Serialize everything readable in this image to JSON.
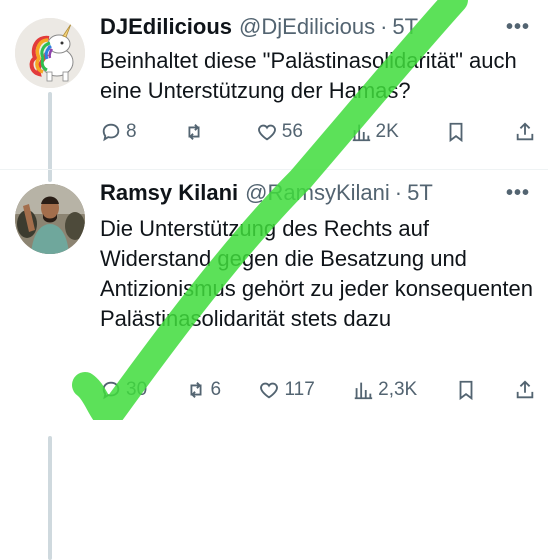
{
  "tweets": [
    {
      "name": "DJEdilicious",
      "handle": "@DjEdilicious",
      "separator": "·",
      "time": "5T",
      "more_icon": "more-horizontal-icon",
      "text": "Beinhaltet diese \"Palästinasolidarität\" auch eine Unterstützung der Hamas?",
      "replies": "8",
      "retweets": "",
      "likes": "56",
      "views": "2K"
    },
    {
      "name": "Ramsy Kilani",
      "handle": "@RamsyKilani",
      "separator": "·",
      "time": "5T",
      "more_icon": "more-horizontal-icon",
      "text": "Die Unterstützung des Rechts auf Widerstand gegen die Besatzung und Antizionismus gehört zu jeder konsequenten Palästinasolidarität stets dazu",
      "replies": "30",
      "retweets": "6",
      "likes": "117",
      "views": "2,3K"
    }
  ],
  "overlay": {
    "stroke_color": "#3fdc3c",
    "shape": "checkmark"
  },
  "colors": {
    "text": "#0f1419",
    "secondary": "#536471",
    "thread_line": "#cfd9de"
  }
}
